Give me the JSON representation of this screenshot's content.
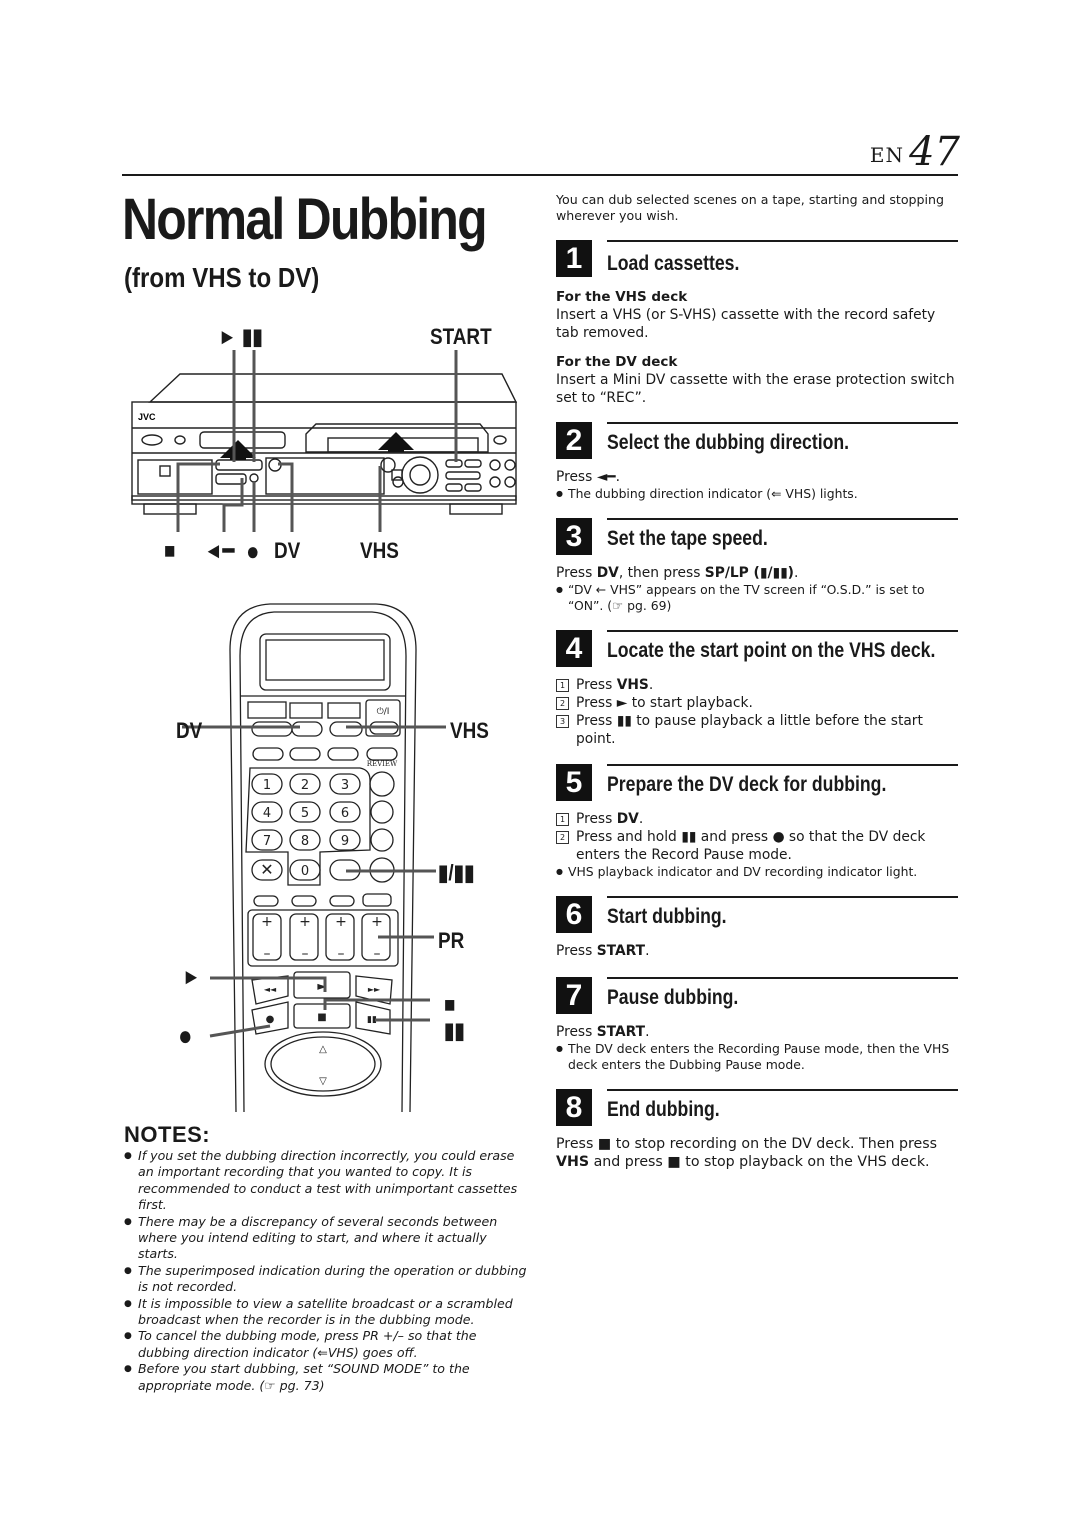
{
  "header": {
    "lang": "EN",
    "page": "47"
  },
  "title": "Normal Dubbing",
  "subtitle": "(from VHS to DV)",
  "vcr_figure": {
    "brand": "JVC",
    "callouts_top": {
      "play_pause": "► ▮▮",
      "start": "START"
    },
    "callouts_bottom": {
      "stop": "■",
      "direction": "◄━",
      "record": "●",
      "dv": "DV",
      "vhs": "VHS"
    }
  },
  "remote_figure": {
    "callouts": {
      "dv": "DV",
      "vhs": "VHS",
      "speed": "▮/▮▮",
      "pr": "PR",
      "play": "►",
      "stop": "■",
      "record": "●",
      "pause": "▮▮"
    },
    "keys": [
      "1",
      "2",
      "3",
      "4",
      "5",
      "6",
      "7",
      "8",
      "9",
      "0"
    ],
    "power_label": "⏻/I",
    "review_label": "REVIEW"
  },
  "intro": "You can dub selected scenes on a tape, starting and stopping wherever you wish.",
  "steps": [
    {
      "num": "1",
      "title": "Load cassettes.",
      "vhs_label": "For the VHS deck",
      "vhs_text": "Insert a VHS (or S-VHS) cassette with the record safety tab removed.",
      "dv_label": "For the DV deck",
      "dv_text": "Insert a Mini DV cassette with the erase protection switch set to “REC”."
    },
    {
      "num": "2",
      "title": "Select the dubbing direction.",
      "text": "Press ◄━.",
      "bullet": "The dubbing direction indicator (⇐ VHS) lights."
    },
    {
      "num": "3",
      "title": "Set the tape speed.",
      "text_a": "Press ",
      "text_b": "DV",
      "text_c": ", then press ",
      "text_d": "SP/LP (▮/▮▮)",
      "text_e": ".",
      "bullet": "“DV ← VHS” appears on the TV screen if “O.S.D.” is set to “ON”. (☞ pg. 69)"
    },
    {
      "num": "4",
      "title": "Locate the start point on the VHS deck.",
      "items": [
        {
          "n": "1",
          "a": "Press ",
          "b": "VHS",
          "c": "."
        },
        {
          "n": "2",
          "a": "Press ► to start playback.",
          "b": "",
          "c": ""
        },
        {
          "n": "3",
          "a": "Press ▮▮ to pause playback a little before the start point.",
          "b": "",
          "c": ""
        }
      ]
    },
    {
      "num": "5",
      "title": "Prepare the DV deck for dubbing.",
      "items": [
        {
          "n": "1",
          "a": "Press ",
          "b": "DV",
          "c": "."
        },
        {
          "n": "2",
          "a": "Press and hold ▮▮ and press ● so that the DV deck enters the Record Pause mode.",
          "b": "",
          "c": ""
        }
      ],
      "bullet": "VHS playback indicator and DV recording indicator light."
    },
    {
      "num": "6",
      "title": "Start dubbing.",
      "text_a": "Press ",
      "text_b": "START",
      "text_c": "."
    },
    {
      "num": "7",
      "title": "Pause dubbing.",
      "text_a": "Press ",
      "text_b": "START",
      "text_c": ".",
      "bullet": "The DV deck enters the Recording Pause mode, then the VHS deck enters the Dubbing Pause mode."
    },
    {
      "num": "8",
      "title": "End dubbing.",
      "text_a": "Press ■ to stop recording on the DV deck. Then press ",
      "text_b": "VHS",
      "text_c": " and press ■ to stop playback on the VHS deck."
    }
  ],
  "notes": {
    "title": "NOTES:",
    "items": [
      "If you set the dubbing direction incorrectly, you could erase an important recording that you wanted to copy. It is recommended to conduct a test with unimportant cassettes first.",
      "There may be a discrepancy of several seconds between where you intend editing to start, and where it actually starts.",
      "The superimposed indication during the operation or dubbing is not recorded.",
      "It is impossible to view a satellite broadcast or a scrambled broadcast when the recorder is in the dubbing mode.",
      "To cancel the dubbing mode, press PR +/– so that the dubbing direction indicator (⇐VHS) goes off.",
      "Before you start dubbing, set “SOUND MODE” to the appropriate mode. (☞ pg. 73)"
    ]
  }
}
